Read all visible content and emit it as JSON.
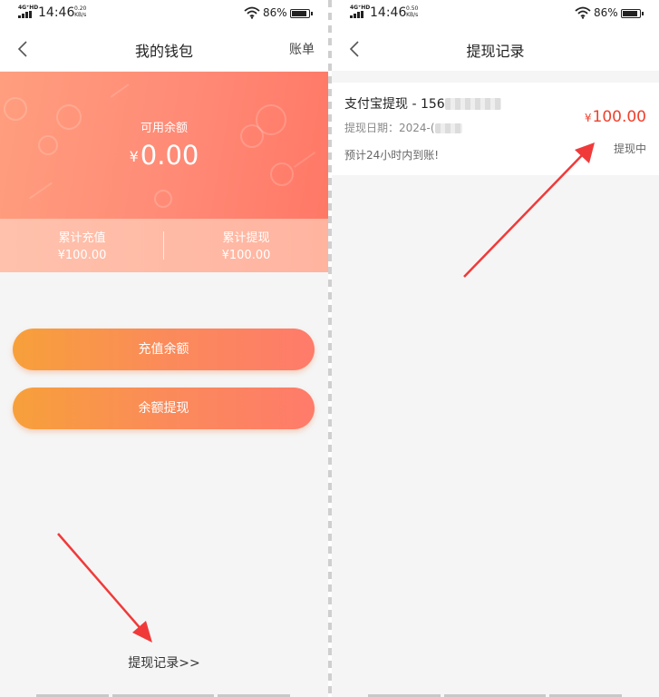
{
  "status_bar_left": {
    "network": "4G⁺HD",
    "time": "14:46",
    "speed_value": "0.20",
    "speed_unit": "KB/s",
    "battery": "86%"
  },
  "status_bar_right": {
    "network": "4G⁺HD",
    "time": "14:46",
    "speed_value": "0.50",
    "speed_unit": "KB/s",
    "battery": "86%"
  },
  "wallet": {
    "nav": {
      "title": "我的钱包",
      "right_action": "账单"
    },
    "balance": {
      "label": "可用余额",
      "currency": "¥",
      "amount": "0.00"
    },
    "stats": [
      {
        "label": "累计充值",
        "value": "¥100.00"
      },
      {
        "label": "累计提现",
        "value": "¥100.00"
      }
    ],
    "buttons": {
      "recharge": "充值余额",
      "withdraw": "余额提现"
    },
    "record_link": "提现记录>>"
  },
  "records": {
    "nav": {
      "title": "提现记录"
    },
    "items": [
      {
        "title_prefix": "支付宝提现 - 156",
        "date_prefix": "提现日期：2024-(",
        "note": "预计24小时内到账!",
        "currency": "¥",
        "amount": "100.00",
        "status": "提现中"
      }
    ]
  },
  "colors": {
    "card_gradient": "#ff8a76",
    "button_gradient_start": "#f7a03a",
    "button_gradient_end": "#fe7b6a",
    "amount_red": "#f0402c",
    "annotation_arrow": "#f03a3a"
  },
  "icons": {
    "back": "chevron-left-icon",
    "wifi": "wifi-icon",
    "battery": "battery-icon",
    "signal": "signal-icon"
  }
}
